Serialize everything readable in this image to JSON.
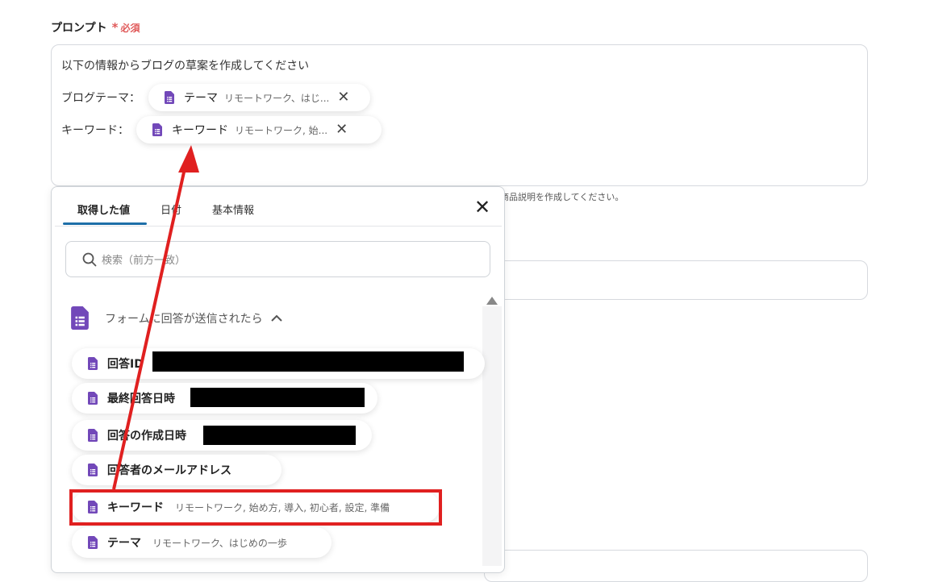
{
  "field": {
    "label": "プロンプト",
    "required_mark": "*",
    "required_text": "必須",
    "line1": "以下の情報からブログの草案を作成してください",
    "rows": [
      {
        "label": "ブログテーマ：",
        "pill_name": "テーマ",
        "pill_value": "リモートワーク、はじ..."
      },
      {
        "label": "キーワード：",
        "pill_name": "キーワード",
        "pill_value": "リモートワーク, 始..."
      }
    ],
    "hint": "商品説明を作成してください。"
  },
  "panel": {
    "tabs": [
      {
        "label": "取得した値",
        "active": true
      },
      {
        "label": "日付",
        "active": false
      },
      {
        "label": "基本情報",
        "active": false
      }
    ],
    "close_glyph": "✕",
    "search_placeholder": "検索（前方一致）",
    "section_title": "フォームに回答が送信されたら",
    "section_chevron": "^",
    "items": [
      {
        "name": "回答ID",
        "value": ""
      },
      {
        "name": "最終回答日時",
        "value": ""
      },
      {
        "name": "回答の作成日時",
        "value": ""
      },
      {
        "name": "回答者のメールアドレス",
        "value": ""
      },
      {
        "name": "キーワード",
        "value": "リモートワーク, 始め方, 導入, 初心者, 設定, 準備"
      },
      {
        "name": "テーマ",
        "value": "リモートワーク、はじめの一歩"
      }
    ]
  },
  "colors": {
    "accent": "#1e6fa8",
    "forms_purple": "#7248b9",
    "required": "#e05a5a",
    "annotation_red": "#e02020"
  },
  "icons": {
    "doc": "google-forms-icon",
    "search": "search-icon",
    "close": "close-icon",
    "chevron": "chevron-up-icon"
  }
}
